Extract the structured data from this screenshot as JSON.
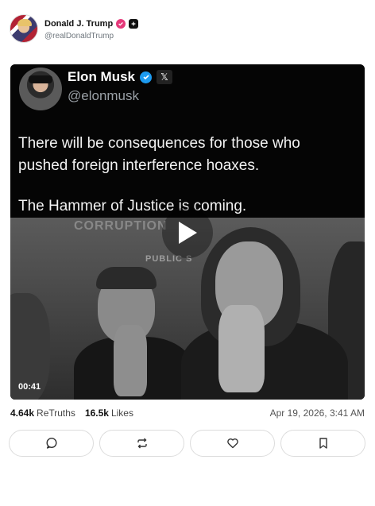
{
  "post": {
    "author": {
      "display_name": "Donald J. Trump",
      "handle": "@realDonaldTrump",
      "verified_color": "#e5397a"
    },
    "media": {
      "quote": {
        "name": "Elon Musk",
        "handle": "@elonmusk",
        "text_line1": "There will be consequences for those who pushed foreign interference hoaxes.",
        "text_line2": "The Hammer of Justice is coming.",
        "verified_color": "#1d9bf0",
        "x_badge": "𝕏"
      },
      "background_sign": "CORRUPTION",
      "background_sign2": "PUBLIC S",
      "duration": "00:41"
    },
    "stats": {
      "retruths_count": "4.64k",
      "retruths_label": "ReTruths",
      "likes_count": "16.5k",
      "likes_label": "Likes",
      "timestamp": "Apr 19, 2026, 3:41 AM"
    },
    "actions": [
      "reply-icon",
      "retruth-icon",
      "like-icon",
      "bookmark-icon"
    ]
  }
}
